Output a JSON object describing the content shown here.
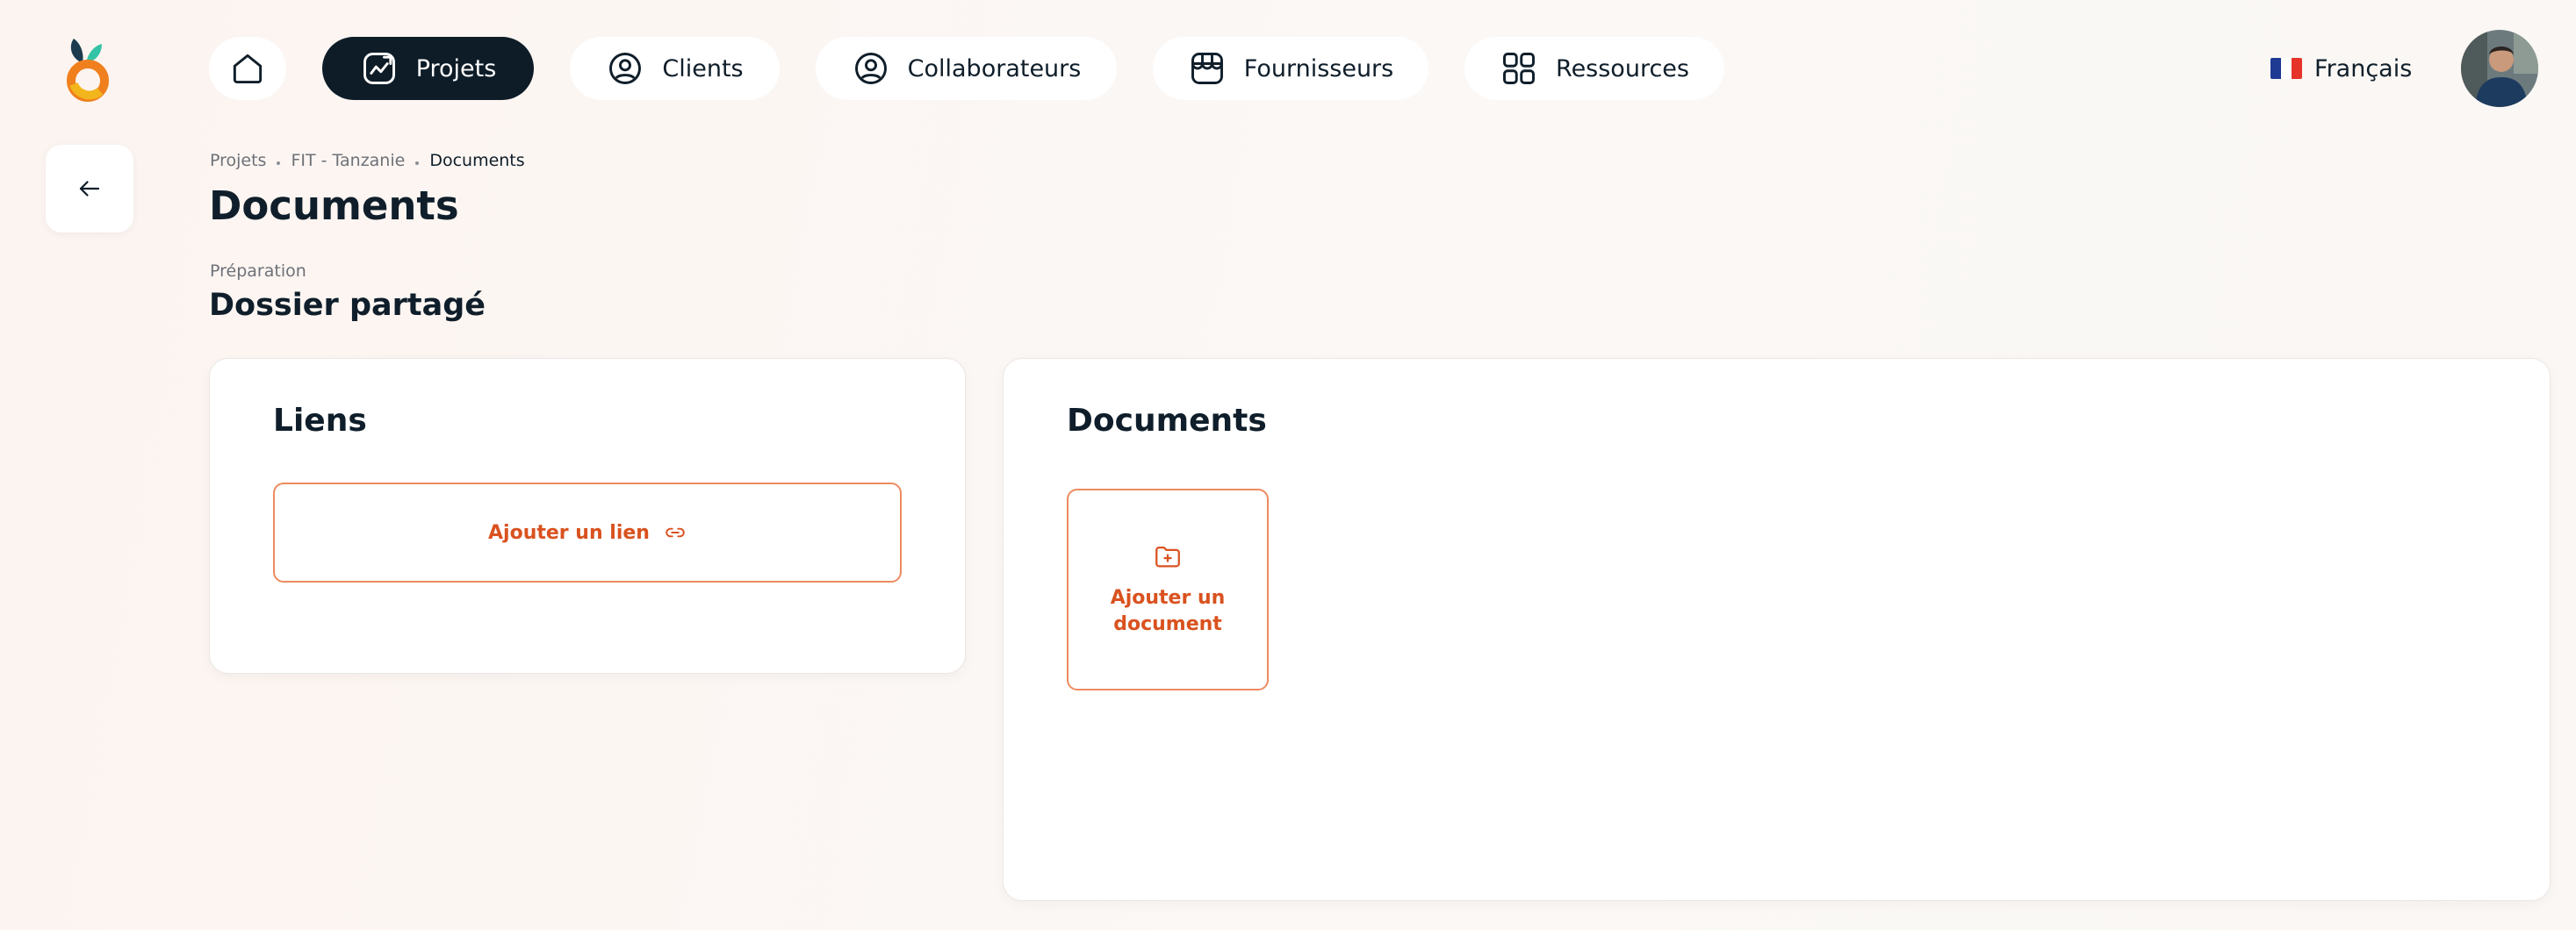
{
  "nav": {
    "projets": "Projets",
    "clients": "Clients",
    "collaborateurs": "Collaborateurs",
    "fournisseurs": "Fournisseurs",
    "ressources": "Ressources"
  },
  "language": {
    "label": "Français"
  },
  "breadcrumb": {
    "items": [
      "Projets",
      "FIT - Tanzanie",
      "Documents"
    ]
  },
  "page": {
    "title": "Documents"
  },
  "section": {
    "subtitle": "Préparation",
    "title": "Dossier partagé"
  },
  "links_card": {
    "title": "Liens",
    "add_label": "Ajouter un lien"
  },
  "docs_card": {
    "title": "Documents",
    "add_label": "Ajouter un document"
  },
  "colors": {
    "accent": "#d9521f",
    "accent_border": "#ee8a60",
    "dark": "#0e1c27"
  }
}
